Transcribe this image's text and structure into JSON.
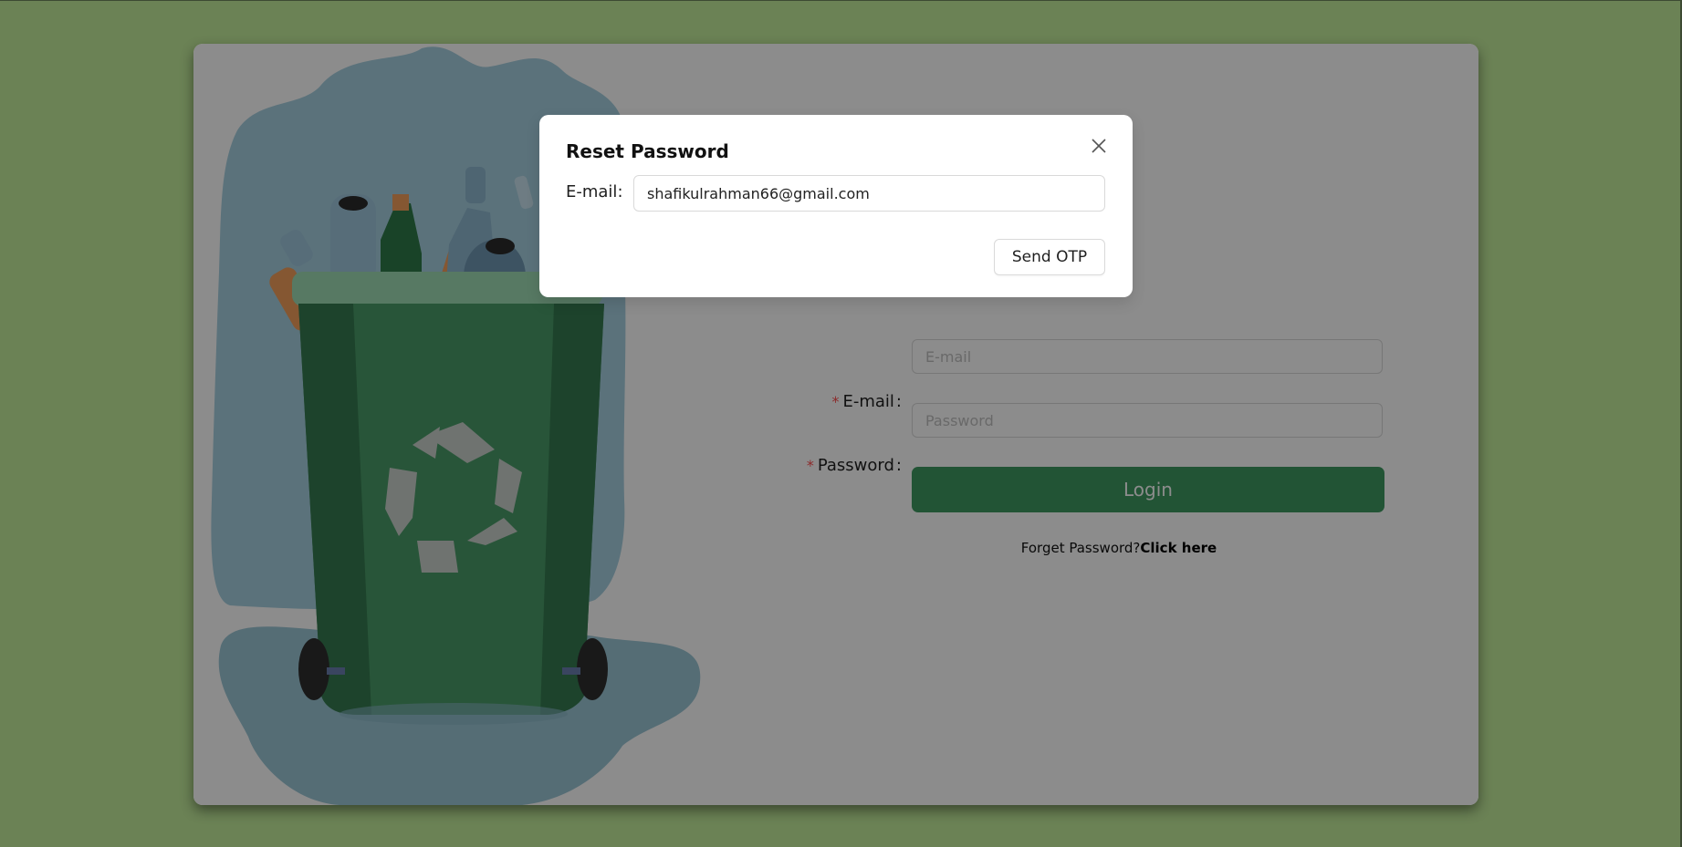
{
  "login": {
    "email_label": "E-mail",
    "email_placeholder": "E-mail",
    "password_label": "Password",
    "password_placeholder": "Password",
    "required_mark": "*",
    "colon": ":",
    "login_button": "Login",
    "forget_text": "Forget Password?",
    "forget_link": "Click here"
  },
  "modal": {
    "title": "Reset Password",
    "email_label": "E-mail",
    "email_value": "shafikulrahman66@gmail.com",
    "send_button": "Send OTP",
    "close_icon": "close-icon"
  },
  "illustration": {
    "icon": "recycle-bin-illustration",
    "symbol": "recycle-icon"
  },
  "colors": {
    "background": "#6b8255",
    "primary_button": "#3f9a62",
    "bin_green": "#4a9b68",
    "required": "#ff4d4f"
  }
}
